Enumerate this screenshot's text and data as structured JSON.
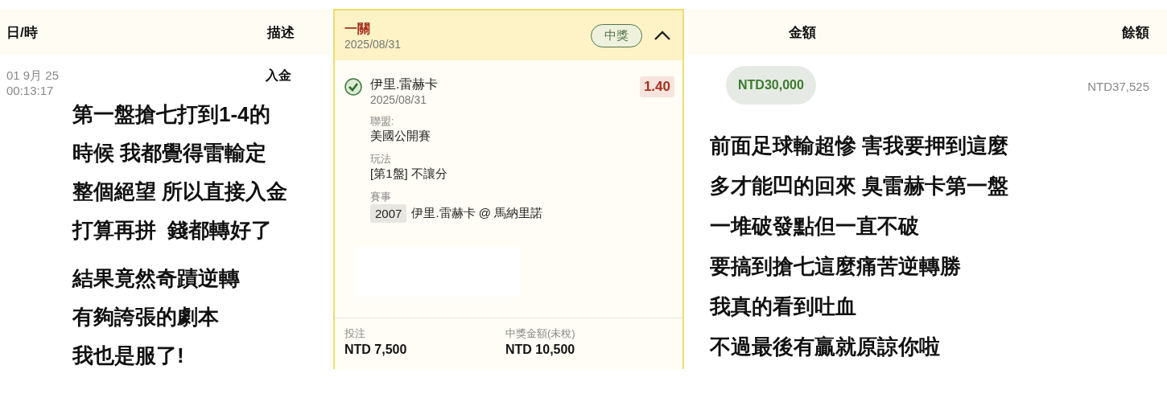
{
  "headers": [
    "日/時",
    "描述",
    "金額",
    "餘額"
  ],
  "row": {
    "date": "01 9月 25",
    "time": "00:13:17",
    "description": "入金",
    "amount": "NTD30,000",
    "balance": "NTD37,525"
  },
  "bet_card": {
    "title": "一關",
    "date": "2025/08/31",
    "status": "中獎",
    "expanded": true,
    "selection": {
      "won": true,
      "name": "伊里.雷赫卡",
      "date": "2025/08/31",
      "odds": "1.40",
      "details": [
        {
          "label": "聯盟:",
          "value": "美國公開賽"
        },
        {
          "label": "玩法",
          "value": "[第1盤] 不讓分"
        },
        {
          "label": "賽事",
          "code": "2007",
          "value": "伊里.雷赫卡 @ 馬納里諾"
        }
      ]
    },
    "stake_label": "投注",
    "stake": "NTD 7,500",
    "payout_label": "中獎金額(未稅)",
    "payout": "NTD 10,500"
  },
  "captions_left": [
    [
      "第一盤搶七打到1-4的",
      "時候 我都覺得雷輸定",
      "整個絕望 所以直接入金",
      "打算再拼  錢都轉好了"
    ],
    [
      "結果竟然奇蹟逆轉",
      "有夠誇張的劇本",
      "我也是服了!"
    ]
  ],
  "captions_right": [
    "前面足球輸超慘 害我要押到這麼",
    "多才能凹的回來 臭雷赫卡第一盤",
    "一堆破發點但一直不破",
    "要搞到搶七這麼痛苦逆轉勝",
    "我真的看到吐血",
    "不過最後有贏就原諒你啦"
  ]
}
